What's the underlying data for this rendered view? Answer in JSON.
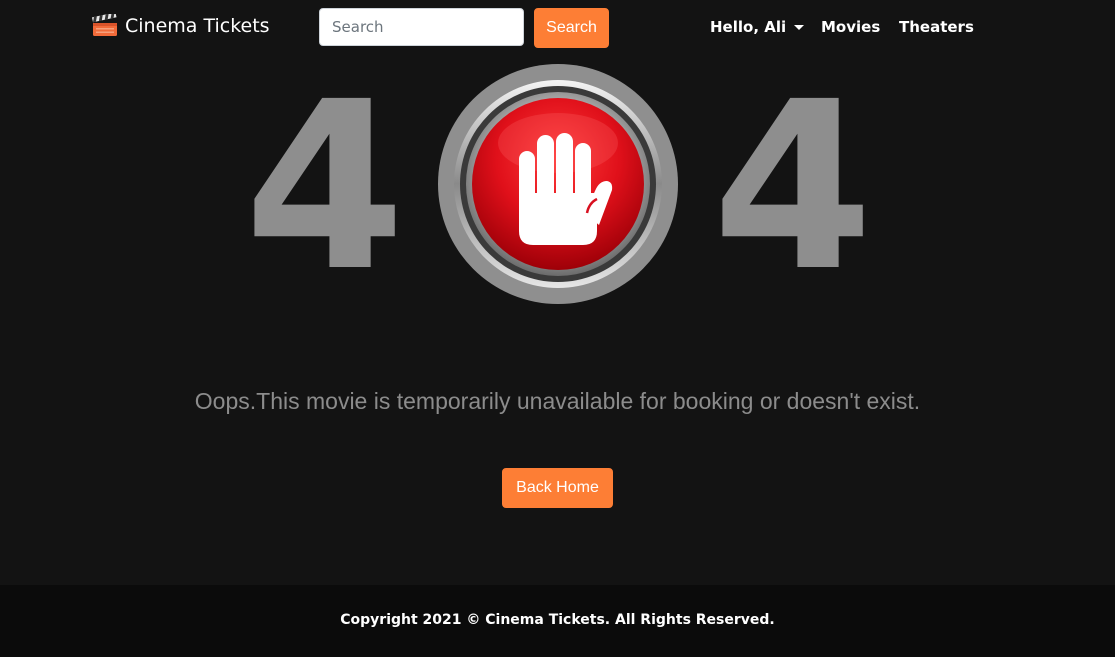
{
  "navbar": {
    "brand_label": "Cinema Tickets",
    "brand_icon": "clapperboard-icon",
    "search": {
      "placeholder": "Search",
      "value": "",
      "button_label": "Search"
    },
    "user_menu_label": "Hello, Ali",
    "links": [
      "Movies",
      "Theaters"
    ]
  },
  "error": {
    "code_digits": [
      "4",
      "4"
    ],
    "center_icon": "stop-hand-icon",
    "message": "Oops.This movie is temporarily unavailable for booking or doesn't exist.",
    "back_button_label": "Back Home"
  },
  "footer": {
    "copyright": "Copyright 2021 © Cinema Tickets. All Rights Reserved."
  },
  "colors": {
    "background": "#131313",
    "accent": "#fd7e35",
    "digit": "#8e8e8e",
    "message": "#8c8c8c",
    "stop_red": "#e0101a",
    "footer_background": "#0b0b0b"
  }
}
